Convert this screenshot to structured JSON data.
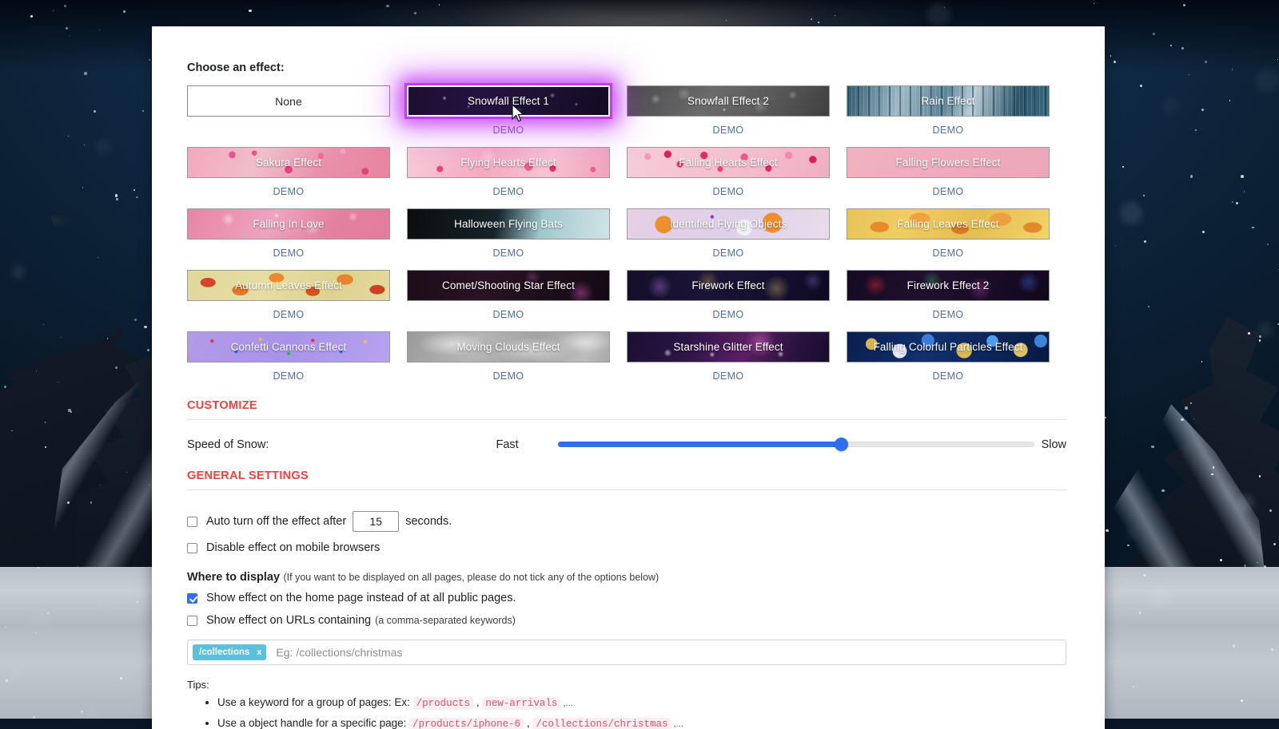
{
  "page": {
    "choose_label": "Choose an effect:",
    "none_label": "None",
    "demo_label": "DEMO"
  },
  "effects": [
    {
      "label": "None",
      "bg": "bg-none",
      "demo": false,
      "selected": false
    },
    {
      "label": "Snowfall Effect 1",
      "bg": "bg-snow1",
      "demo": true,
      "selected": true
    },
    {
      "label": "Snowfall Effect 2",
      "bg": "bg-snow2",
      "demo": true,
      "selected": false
    },
    {
      "label": "Rain Effect",
      "bg": "bg-rain",
      "demo": true,
      "selected": false
    },
    {
      "label": "Sakura Effect",
      "bg": "bg-sakura",
      "demo": true,
      "selected": false
    },
    {
      "label": "Flying Hearts Effect",
      "bg": "bg-hearts-fly",
      "demo": true,
      "selected": false
    },
    {
      "label": "Falling Hearts Effect",
      "bg": "bg-hearts-fall",
      "demo": true,
      "selected": false
    },
    {
      "label": "Falling Flowers Effect",
      "bg": "bg-flowers-fall",
      "demo": true,
      "selected": false
    },
    {
      "label": "Falling In Love",
      "bg": "bg-falling-love",
      "demo": true,
      "selected": false
    },
    {
      "label": "Halloween Flying Bats",
      "bg": "bg-bats",
      "demo": true,
      "selected": false
    },
    {
      "label": "Identified Flying Objects",
      "bg": "bg-ifo",
      "demo": true,
      "selected": false
    },
    {
      "label": "Falling Leaves Effect",
      "bg": "bg-leaves-fall",
      "demo": true,
      "selected": false
    },
    {
      "label": "Autumn Leaves Effect",
      "bg": "bg-autumn",
      "demo": true,
      "selected": false
    },
    {
      "label": "Comet/Shooting Star Effect",
      "bg": "bg-comet",
      "demo": true,
      "selected": false
    },
    {
      "label": "Firework Effect",
      "bg": "bg-firework",
      "demo": true,
      "selected": false
    },
    {
      "label": "Firework Effect 2",
      "bg": "bg-firework2",
      "demo": true,
      "selected": false
    },
    {
      "label": "Confetti Cannons Effect",
      "bg": "bg-confetti",
      "demo": true,
      "selected": false
    },
    {
      "label": "Moving Clouds Effect",
      "bg": "bg-clouds",
      "demo": true,
      "selected": false
    },
    {
      "label": "Starshine Glitter Effect",
      "bg": "bg-starshine",
      "demo": true,
      "selected": false
    },
    {
      "label": "Falling Colorful Particles Effect",
      "bg": "bg-particles",
      "demo": true,
      "selected": false
    }
  ],
  "customize": {
    "header": "CUSTOMIZE",
    "speed_label": "Speed of Snow:",
    "fast_label": "Fast",
    "slow_label": "Slow",
    "slider_percent": 60
  },
  "general": {
    "header": "GENERAL SETTINGS",
    "auto_off_prefix": "Auto turn off the effect after",
    "auto_off_value": "15",
    "auto_off_suffix": "seconds.",
    "auto_off_checked": false,
    "disable_mobile_label": "Disable effect on mobile browsers",
    "disable_mobile_checked": false,
    "where_title": "Where to display",
    "where_note": "(If you want to be displayed on all pages, please do not tick any of the options below)",
    "home_page_label": "Show effect on the home page instead of at all public pages.",
    "home_page_checked": true,
    "urls_label": "Show effect on URLs containing",
    "urls_note": "(a comma-separated keywords)",
    "urls_checked": false,
    "tag_value": "/collections",
    "tag_remove": "x",
    "tag_placeholder": "Eg: /collections/christmas"
  },
  "tips": {
    "title": "Tips:",
    "items": [
      {
        "text": "Use a keyword for a group of pages: Ex:",
        "codes": [
          "/products",
          "new-arrivals"
        ],
        "trail": ",..."
      },
      {
        "text": "Use a object handle for a specific page:",
        "codes": [
          "/products/iphone-6",
          "/collections/christmas"
        ],
        "trail": ",..."
      }
    ]
  },
  "colors": {
    "accent_red": "#fa3c3c",
    "link_blue": "#4e6fa8",
    "slider_blue": "#2f6fed",
    "tag_cyan": "#5bc0de",
    "glow_purple": "#c23bf5",
    "code_pink": "#e0526f"
  }
}
